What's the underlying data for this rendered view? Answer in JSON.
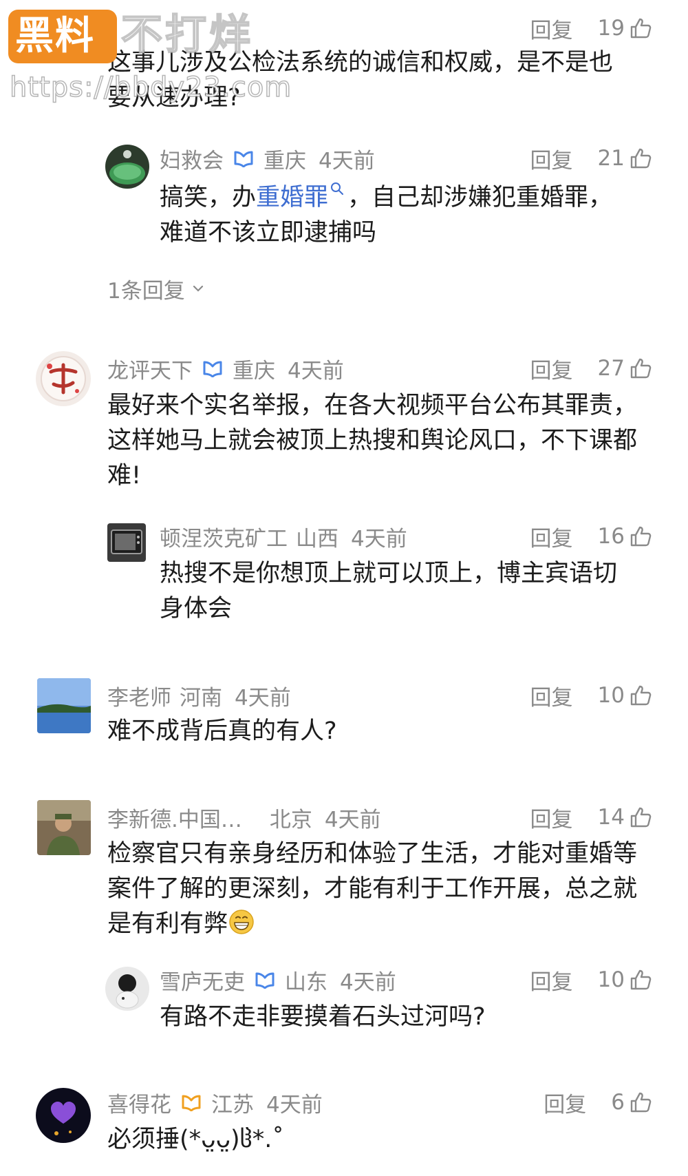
{
  "watermark": {
    "logo_text": "黑料",
    "brand": "不打烊",
    "url": "https://bbdy23.com"
  },
  "comments": [
    {
      "id": "c0",
      "text": "这事儿涉及公检法系统的诚信和权威，是不是也要从速办理?",
      "reply_label": "回复",
      "likes": "19"
    },
    {
      "id": "r0",
      "name": "妇救会",
      "region": "重庆",
      "time": "4天前",
      "text_pre": "搞笑，办",
      "text_link": "重婚罪",
      "text_post": "，自己却涉嫌犯重婚罪，难道不该立即逮捕吗",
      "reply_label": "回复",
      "likes": "21",
      "more_replies": "1条回复"
    },
    {
      "id": "c1",
      "name": "龙评天下",
      "region": "重庆",
      "time": "4天前",
      "text": "最好来个实名举报，在各大视频平台公布其罪责，这样她马上就会被顶上热搜和舆论风口，不下课都难!",
      "reply_label": "回复",
      "likes": "27"
    },
    {
      "id": "r1",
      "name": "顿涅茨克矿工",
      "region": "山西",
      "time": "4天前",
      "text": "热搜不是你想顶上就可以顶上，博主宾语切身体会",
      "reply_label": "回复",
      "likes": "16"
    },
    {
      "id": "c2",
      "name": "李老师",
      "region": "河南",
      "time": "4天前",
      "text": "难不成背后真的有人?",
      "reply_label": "回复",
      "likes": "10"
    },
    {
      "id": "c3",
      "name": "李新德.中国…",
      "region": "北京",
      "time": "4天前",
      "text": "检察官只有亲身经历和体验了生活，才能对重婚等案件了解的更深刻，才能有利于工作开展，总之就是有利有弊",
      "reply_label": "回复",
      "likes": "14"
    },
    {
      "id": "r3",
      "name": "雪庐无吏",
      "region": "山东",
      "time": "4天前",
      "text": "有路不走非要摸着石头过河吗?",
      "reply_label": "回复",
      "likes": "10"
    },
    {
      "id": "c4",
      "name": "喜得花",
      "region": "江苏",
      "time": "4天前",
      "text": "必须捶(*ᴗ̤ᴗ̤)ჱ*.˚",
      "reply_label": "回复",
      "likes": "6"
    }
  ],
  "colors": {
    "meta_gray": "#8a8a8a",
    "link_blue": "#3f6ed1",
    "badge_blue": "#4a86e8",
    "badge_orange": "#f0a020",
    "watermark_orange": "#f08c22"
  }
}
